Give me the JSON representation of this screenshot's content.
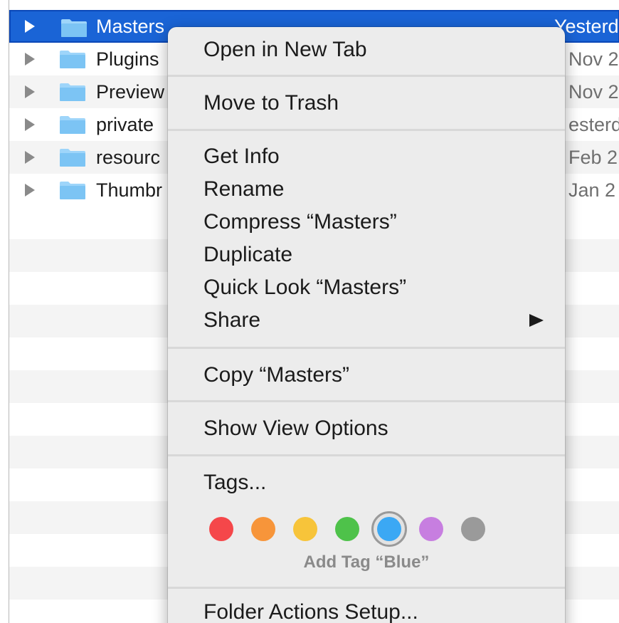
{
  "file_list": {
    "rows": [
      {
        "name": "Masters",
        "date": "Yesterd",
        "selected": true
      },
      {
        "name": "Plugins",
        "date": "Nov 2",
        "selected": false
      },
      {
        "name": "Preview",
        "date": "Nov 2",
        "selected": false
      },
      {
        "name": "private",
        "date": "esterd",
        "selected": false
      },
      {
        "name": "resourc",
        "date": "Feb 2",
        "selected": false
      },
      {
        "name": "Thumbr",
        "date": "Jan 2",
        "selected": false
      }
    ]
  },
  "context_menu": {
    "items": {
      "open_new_tab": "Open in New Tab",
      "move_to_trash": "Move to Trash",
      "get_info": "Get Info",
      "rename": "Rename",
      "compress": "Compress “Masters”",
      "duplicate": "Duplicate",
      "quick_look": "Quick Look “Masters”",
      "share": "Share",
      "copy": "Copy “Masters”",
      "show_view_options": "Show View Options",
      "tags": "Tags...",
      "folder_actions": "Folder Actions Setup..."
    },
    "tag_caption": "Add Tag “Blue”",
    "tag_colors": [
      {
        "name": "red",
        "hex": "#f5474a"
      },
      {
        "name": "orange",
        "hex": "#f7953a"
      },
      {
        "name": "yellow",
        "hex": "#f7c43a"
      },
      {
        "name": "green",
        "hex": "#4ec24a"
      },
      {
        "name": "blue",
        "hex": "#3ba8f4"
      },
      {
        "name": "purple",
        "hex": "#c77ee0"
      },
      {
        "name": "gray",
        "hex": "#9a9a9a"
      }
    ]
  },
  "colors": {
    "selection": "#1a64d6",
    "folder": "#7cc4f4"
  }
}
